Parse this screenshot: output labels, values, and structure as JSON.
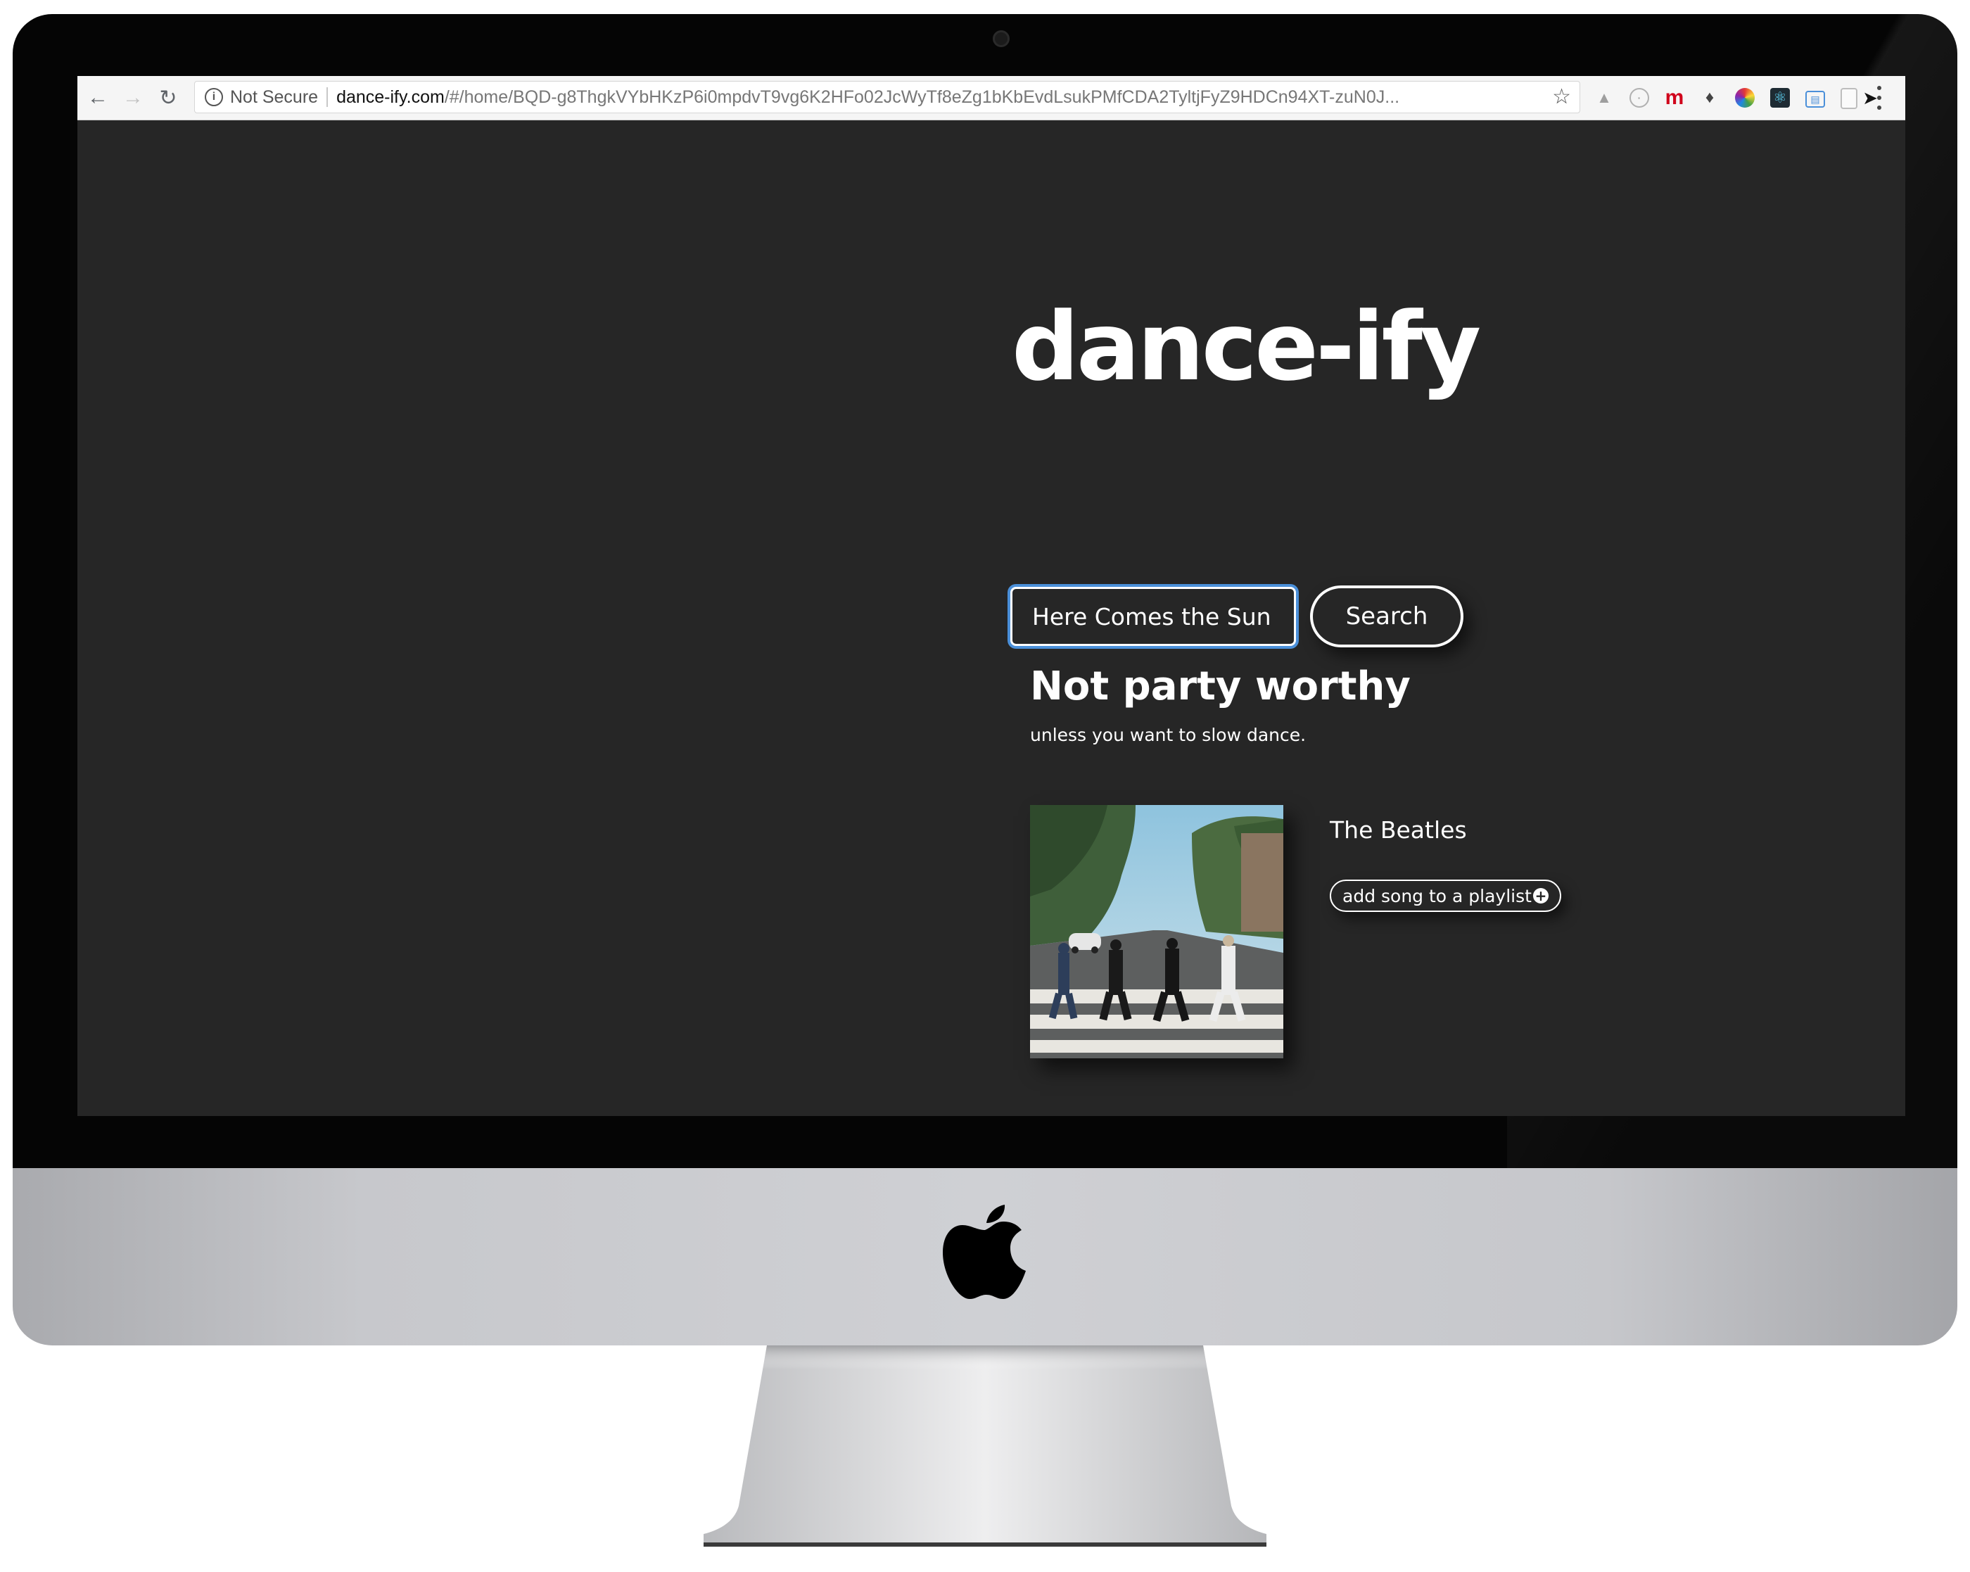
{
  "browser": {
    "security_label": "Not Secure",
    "url_host": "dance-ify.com",
    "url_path": "/#/home/BQD-g8ThgkVYbHKzP6i0mpdvT9vg6K2HFo02JcWyTf8eZg1bKbEvdLsukPMfCDA2TyltjFyZ9HDCn94XT-zuN0J...",
    "extension_badge": "0",
    "extensions_icons": [
      "drive-icon",
      "circle-icon",
      "m-icon",
      "evernote-icon",
      "colorwheel-icon",
      "react-icon",
      "window-icon",
      "page-icon",
      "bird-icon",
      "badge-icon"
    ]
  },
  "app": {
    "title": "dance-ify",
    "search": {
      "value": "Here Comes the Sun",
      "button_label": "Search"
    },
    "result": {
      "verdict": "Not party worthy",
      "subtext": "unless you want to slow dance.",
      "artist": "The Beatles",
      "add_label": "add song to a playlist"
    }
  },
  "colors": {
    "page_bg": "#262626",
    "text": "#ffffff",
    "focus_ring": "#4a8fd9"
  }
}
